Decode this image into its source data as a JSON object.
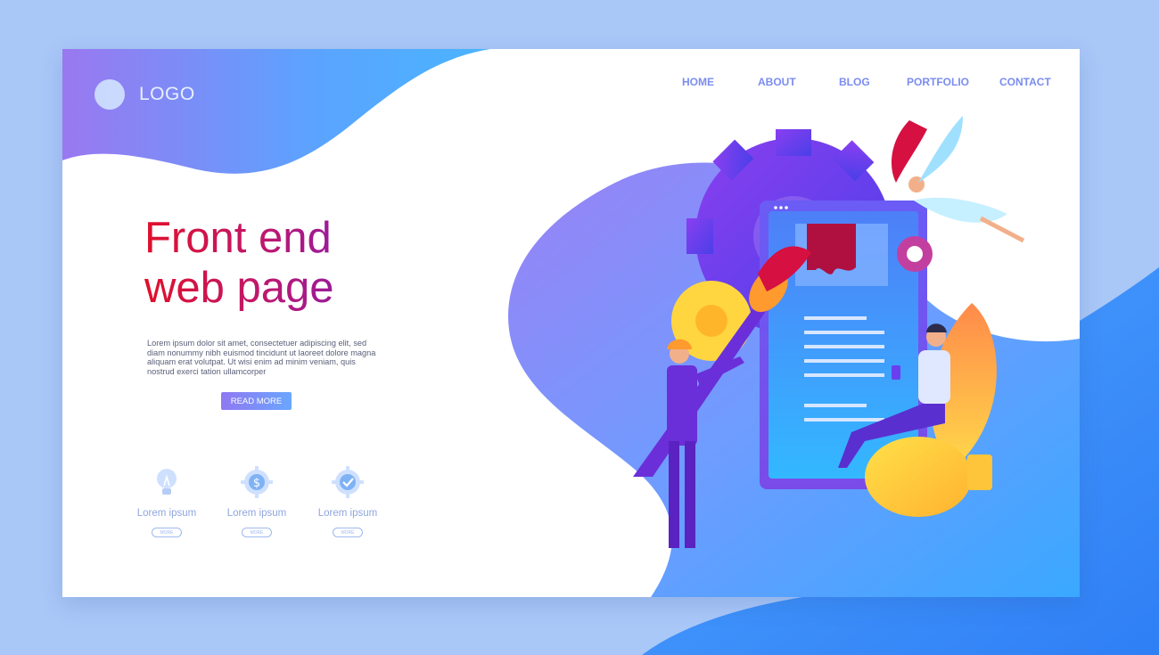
{
  "logo": {
    "text": "LOGO"
  },
  "nav": {
    "home": "HOME",
    "about": "ABOUT",
    "blog": "BLOG",
    "portfolio": "PORTFOLIO",
    "contact": "CONTACT"
  },
  "hero": {
    "title_line1": "Front end",
    "title_line2": "web page",
    "body": "Lorem ipsum dolor sit amet, consectetuer adipiscing elit, sed diam nonummy nibh euismod tincidunt ut laoreet dolore magna aliquam erat volutpat. Ut wisi enim ad minim veniam, quis nostrud exerci tation ullamcorper",
    "cta": "READ MORE"
  },
  "features": [
    {
      "icon": "lightbulb-icon",
      "label": "Lorem ipsum",
      "button": "MORE"
    },
    {
      "icon": "dollar-gear-icon",
      "label": "Lorem ipsum",
      "button": "MORE"
    },
    {
      "icon": "check-gear-icon",
      "label": "Lorem ipsum",
      "button": "MORE"
    }
  ],
  "colors": {
    "accent_red": "#e0102a",
    "accent_purple": "#8f78f2",
    "accent_blue": "#4aa8ff",
    "nav_text": "#7b8cf0"
  }
}
